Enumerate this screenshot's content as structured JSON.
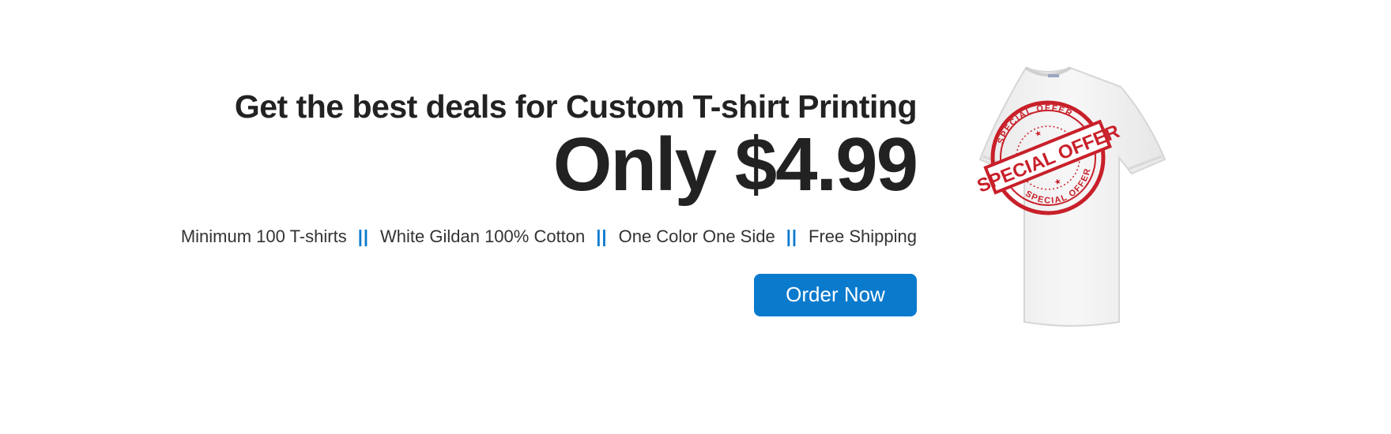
{
  "banner": {
    "headline": "Get the best deals for Custom T-shirt Printing",
    "price": "Only $4.99",
    "features": [
      "Minimum 100 T-shirts",
      "White Gildan 100% Cotton",
      "One Color One Side",
      "Free Shipping"
    ],
    "separator": "||",
    "cta_label": "Order Now"
  },
  "stamp": {
    "main_text": "SPECIAL OFFER",
    "ring_top": "SPECIAL OFFER",
    "ring_bottom": "SPECIAL OFFER"
  },
  "colors": {
    "accent": "#0a7acd",
    "stamp_red": "#c8202a",
    "text": "#222222"
  }
}
